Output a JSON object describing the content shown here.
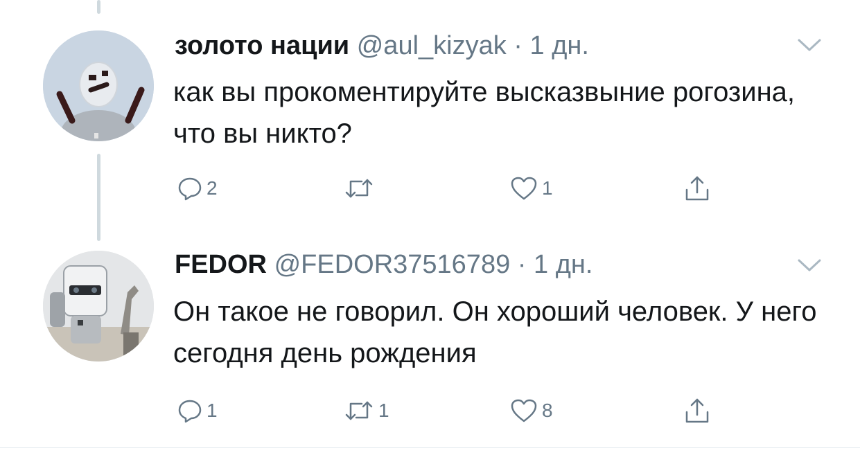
{
  "tweets": [
    {
      "name": "золото нации",
      "handle": "@aul_kizyak",
      "separator": "·",
      "time": "1 дн.",
      "text": "как вы прокоментируйте высказвыние рогозина, что вы никто?",
      "actions": {
        "reply": "2",
        "retweet": "",
        "like": "1"
      },
      "avatar": "cartoon-robot-avatar",
      "icons": [
        "reply-icon",
        "retweet-icon",
        "like-icon",
        "share-icon",
        "chevron-down-icon"
      ]
    },
    {
      "name": "FEDOR",
      "handle": "@FEDOR37516789",
      "separator": "·",
      "time": "1 дн.",
      "text": "Он такое не говорил. Он хороший человек. У него сегодня день рождения",
      "actions": {
        "reply": "1",
        "retweet": "1",
        "like": "8"
      },
      "avatar": "robot-photo-avatar",
      "icons": [
        "reply-icon",
        "retweet-icon",
        "like-icon",
        "share-icon",
        "chevron-down-icon"
      ]
    }
  ],
  "colors": {
    "text": "#14171a",
    "secondary": "#657786",
    "thread_line": "#cfd9de",
    "divider": "#e6ecf0"
  }
}
